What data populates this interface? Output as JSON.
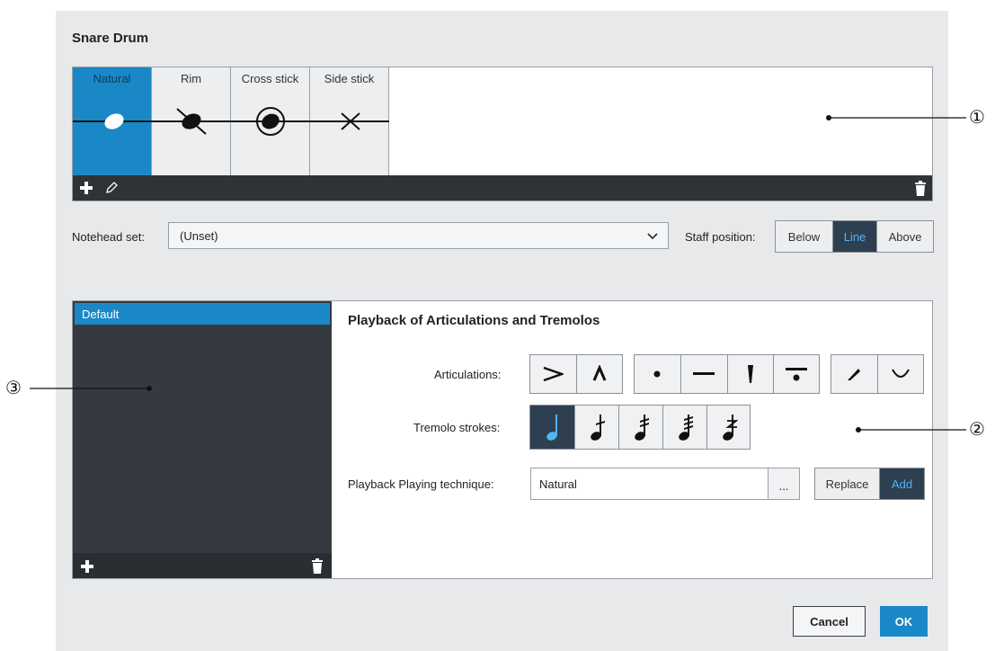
{
  "dialog": {
    "title": "Snare Drum"
  },
  "techniques": [
    {
      "label": "Natural",
      "notehead": "filled-oval-notehead",
      "selected": true
    },
    {
      "label": "Rim",
      "notehead": "slashed-notehead",
      "selected": false
    },
    {
      "label": "Cross stick",
      "notehead": "circled-notehead",
      "selected": false
    },
    {
      "label": "Side stick",
      "notehead": "x-notehead",
      "selected": false
    }
  ],
  "notehead_set": {
    "label": "Notehead set:",
    "value": "(Unset)"
  },
  "staff_position": {
    "label": "Staff position:",
    "options": [
      "Below",
      "Line",
      "Above"
    ],
    "selected": "Line"
  },
  "sets": {
    "items": [
      "Default"
    ],
    "selected": "Default"
  },
  "playback": {
    "title": "Playback of Articulations and Tremolos",
    "articulations_label": "Articulations:",
    "articulations": [
      "accent",
      "marcato",
      "staccato",
      "tenuto",
      "staccatissimo",
      "tenuto-staccato",
      "stress",
      "unstress"
    ],
    "tremolo_label": "Tremolo strokes:",
    "tremolos": [
      "no-tremolo",
      "one-stroke",
      "two-strokes",
      "three-strokes",
      "buzz-roll"
    ],
    "tremolo_selected": "no-tremolo",
    "technique_label": "Playback Playing technique:",
    "technique_value": "Natural",
    "more_label": "...",
    "mode_options": [
      "Replace",
      "Add"
    ],
    "mode_selected": "Add"
  },
  "buttons": {
    "cancel": "Cancel",
    "ok": "OK"
  },
  "callouts": [
    "①",
    "②",
    "③"
  ],
  "colors": {
    "accent": "#1a88c7",
    "dark_panel": "#353a41",
    "toolbar": "#2f3338",
    "selected_text": "#4fb6f2"
  }
}
